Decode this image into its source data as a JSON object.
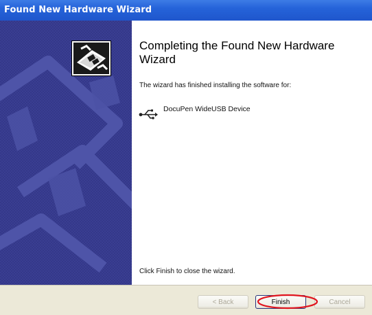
{
  "window": {
    "title": "Found New Hardware Wizard"
  },
  "content": {
    "heading": "Completing the Found New Hardware Wizard",
    "intro": "The wizard has finished installing the software for:",
    "device_name": "DocuPen WideUSB Device",
    "closing": "Click Finish to close the wizard."
  },
  "buttons": {
    "back": "< Back",
    "finish": "Finish",
    "cancel": "Cancel"
  },
  "icons": {
    "side": "hardware-icon",
    "device": "usb-icon"
  },
  "colors": {
    "titlebar": "#2563d9",
    "side_panel": "#3a3e92",
    "button_bar": "#ece9d8",
    "annotation_circle": "#e0141e"
  }
}
